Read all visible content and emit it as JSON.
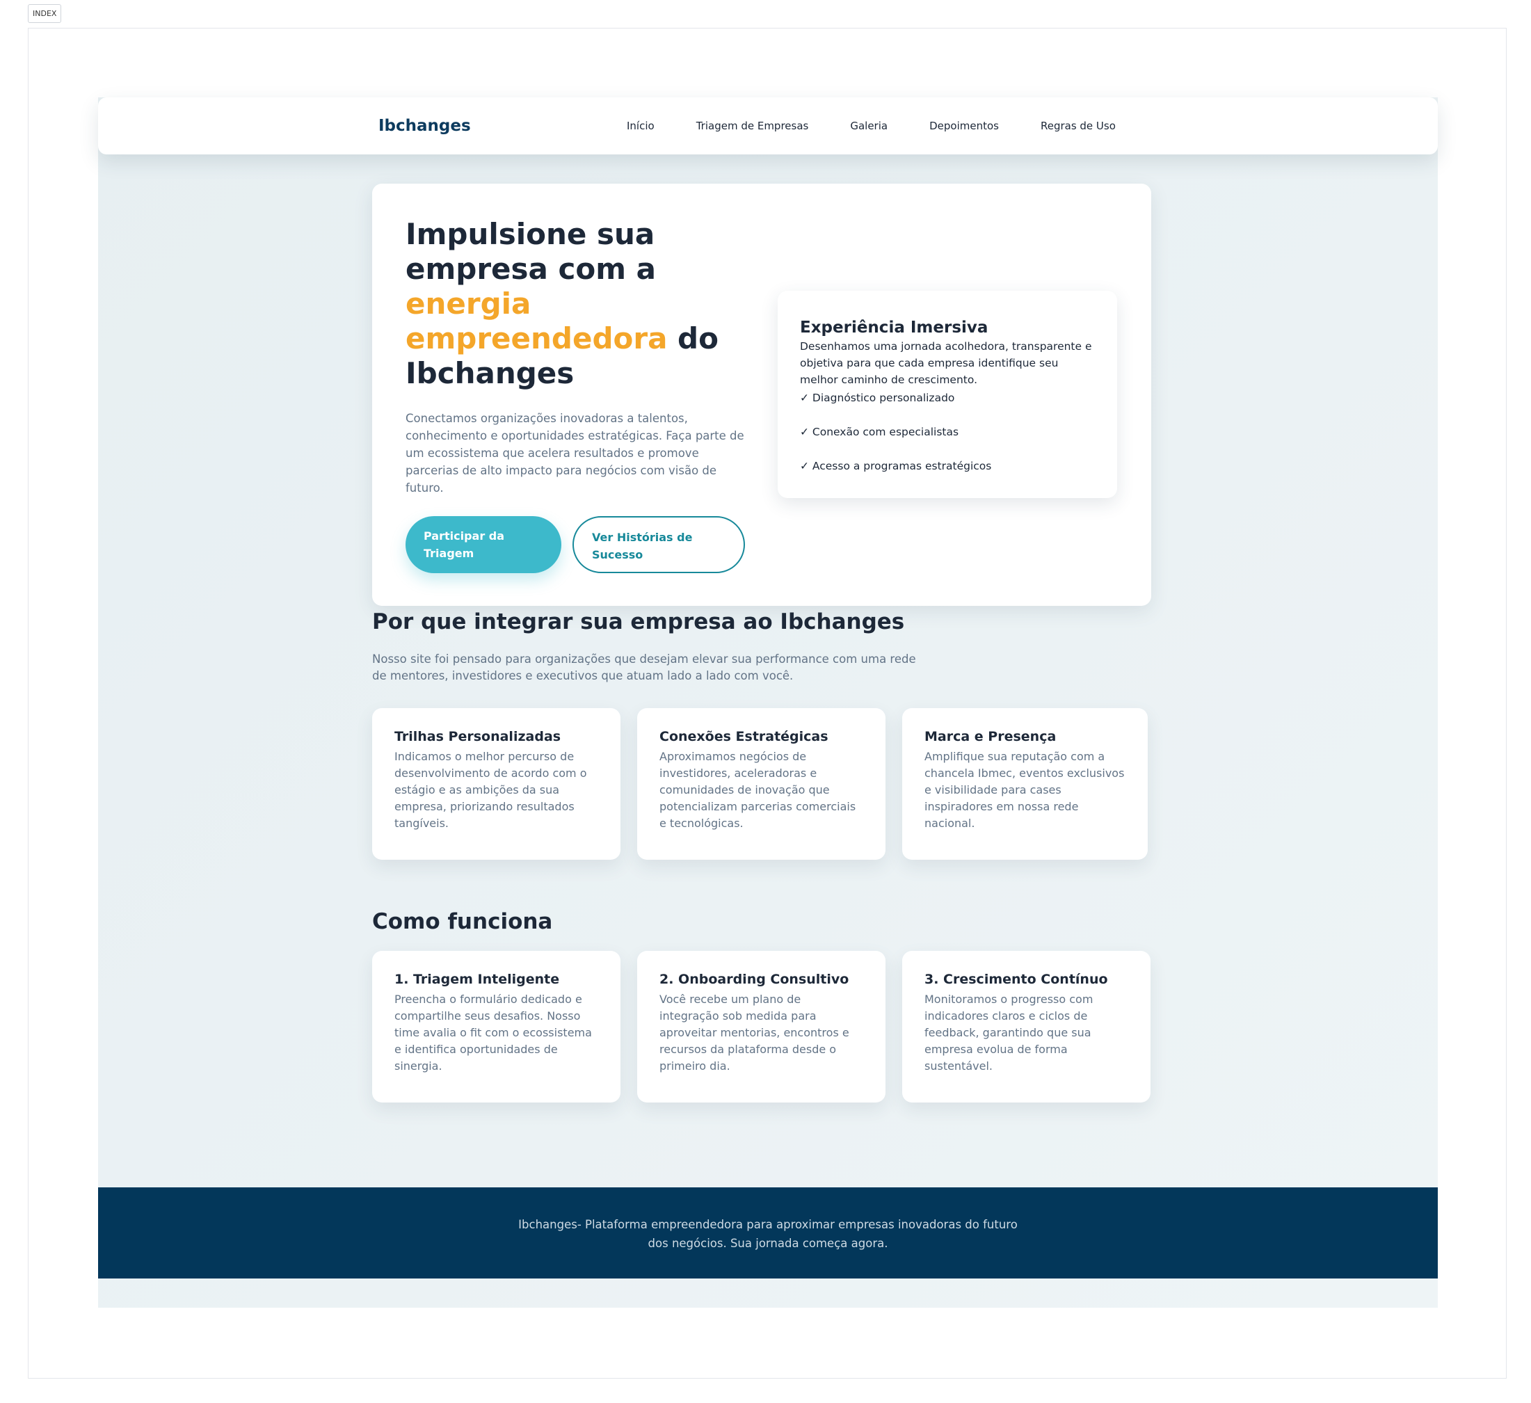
{
  "tag": "INDEX",
  "nav": {
    "logo": "Ibchanges",
    "links": [
      "Início",
      "Triagem de Empresas",
      "Galeria",
      "Depoimentos",
      "Regras de Uso"
    ]
  },
  "hero": {
    "title_part1": "Impulsione sua empresa com a ",
    "title_highlight": "energia empreendedora",
    "title_part2": " do Ibchanges",
    "lead": "Conectamos organizações inovadoras a talentos, conhecimento e oportunidades estratégicas. Faça parte de um ecossistema que acelera resultados e promove parcerias de alto impacto para negócios com visão de futuro.",
    "primary_button": "Participar da Triagem",
    "secondary_button": "Ver Histórias de Sucesso",
    "colors": {
      "highlight": "#f4a62a",
      "primary": "#3db9cb",
      "secondary": "#17899a"
    }
  },
  "experience": {
    "title": "Experiência Imersiva",
    "text": "Desenhamos uma jornada acolhedora, transparente e objetiva para que cada empresa identifique seu melhor caminho de crescimento.",
    "checks": [
      "✓ Diagnóstico personalizado",
      "✓ Conexão com especialistas",
      "✓ Acesso a programas estratégicos"
    ]
  },
  "why": {
    "title": "Por que integrar sua empresa ao Ibchanges",
    "lead": "Nosso site foi pensado para organizações que desejam elevar sua performance com uma rede de mentores, investidores e executivos que atuam lado a lado com você.",
    "cards": [
      {
        "title": "Trilhas Personalizadas",
        "text": "Indicamos o melhor percurso de desenvolvimento de acordo com o estágio e as ambições da sua empresa, priorizando resultados tangíveis."
      },
      {
        "title": "Conexões Estratégicas",
        "text": "Aproximamos negócios de investidores, aceleradoras e comunidades de inovação que potencializam parcerias comerciais e tecnológicas."
      },
      {
        "title": "Marca e Presença",
        "text": "Amplifique sua reputação com a chancela Ibmec, eventos exclusivos e visibilidade para cases inspiradores em nossa rede nacional."
      }
    ]
  },
  "how": {
    "title": "Como funciona",
    "cards": [
      {
        "title": "1. Triagem Inteligente",
        "text": "Preencha o formulário dedicado e compartilhe seus desafios. Nosso time avalia o fit com o ecossistema e identifica oportunidades de sinergia."
      },
      {
        "title": "2. Onboarding Consultivo",
        "text": "Você recebe um plano de integração sob medida para aproveitar mentorias, encontros e recursos da plataforma desde o primeiro dia."
      },
      {
        "title": "3. Crescimento Contínuo",
        "text": "Monitoramos o progresso com indicadores claros e ciclos de feedback, garantindo que sua empresa evolua de forma sustentável."
      }
    ]
  },
  "footer": {
    "text": "Ibchanges- Plataforma empreendedora para aproximar empresas inovadoras do futuro dos negócios. Sua jornada começa agora.",
    "background": "#03375a"
  }
}
